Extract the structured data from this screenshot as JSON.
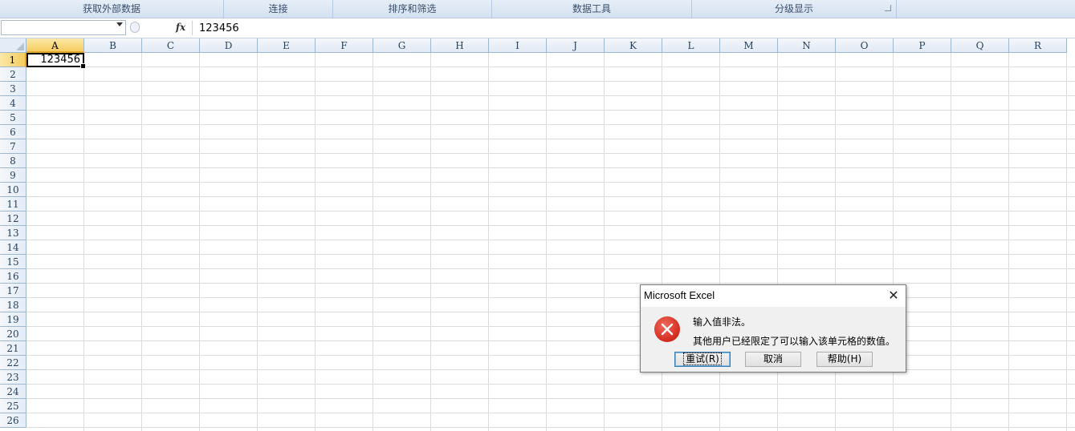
{
  "ribbon": {
    "groups": [
      {
        "label": "获取外部数据"
      },
      {
        "label": "连接"
      },
      {
        "label": "排序和筛选"
      },
      {
        "label": "数据工具"
      },
      {
        "label": "分级显示"
      }
    ]
  },
  "formula_bar": {
    "name_box": "",
    "fx_label": "fx",
    "content": "123456"
  },
  "grid": {
    "columns": [
      "A",
      "B",
      "C",
      "D",
      "E",
      "F",
      "G",
      "H",
      "I",
      "J",
      "K",
      "L",
      "M",
      "N",
      "O",
      "P",
      "Q",
      "R"
    ],
    "rows": [
      "1",
      "2",
      "3",
      "4",
      "5",
      "6",
      "7",
      "8",
      "9",
      "10",
      "11",
      "12",
      "13",
      "14",
      "15",
      "16",
      "17",
      "18",
      "19",
      "20",
      "21",
      "22",
      "23",
      "24",
      "25",
      "26"
    ],
    "selected_cell": "A1",
    "cells": {
      "A1": "123456"
    }
  },
  "dialog": {
    "title": "Microsoft Excel",
    "close_glyph": "✕",
    "icon": "error-icon",
    "message_line1": "输入值非法。",
    "message_line2": "其他用户已经限定了可以输入该单元格的数值。",
    "buttons": {
      "retry": "重试(R)",
      "cancel": "取消",
      "help": "帮助(H)"
    }
  }
}
